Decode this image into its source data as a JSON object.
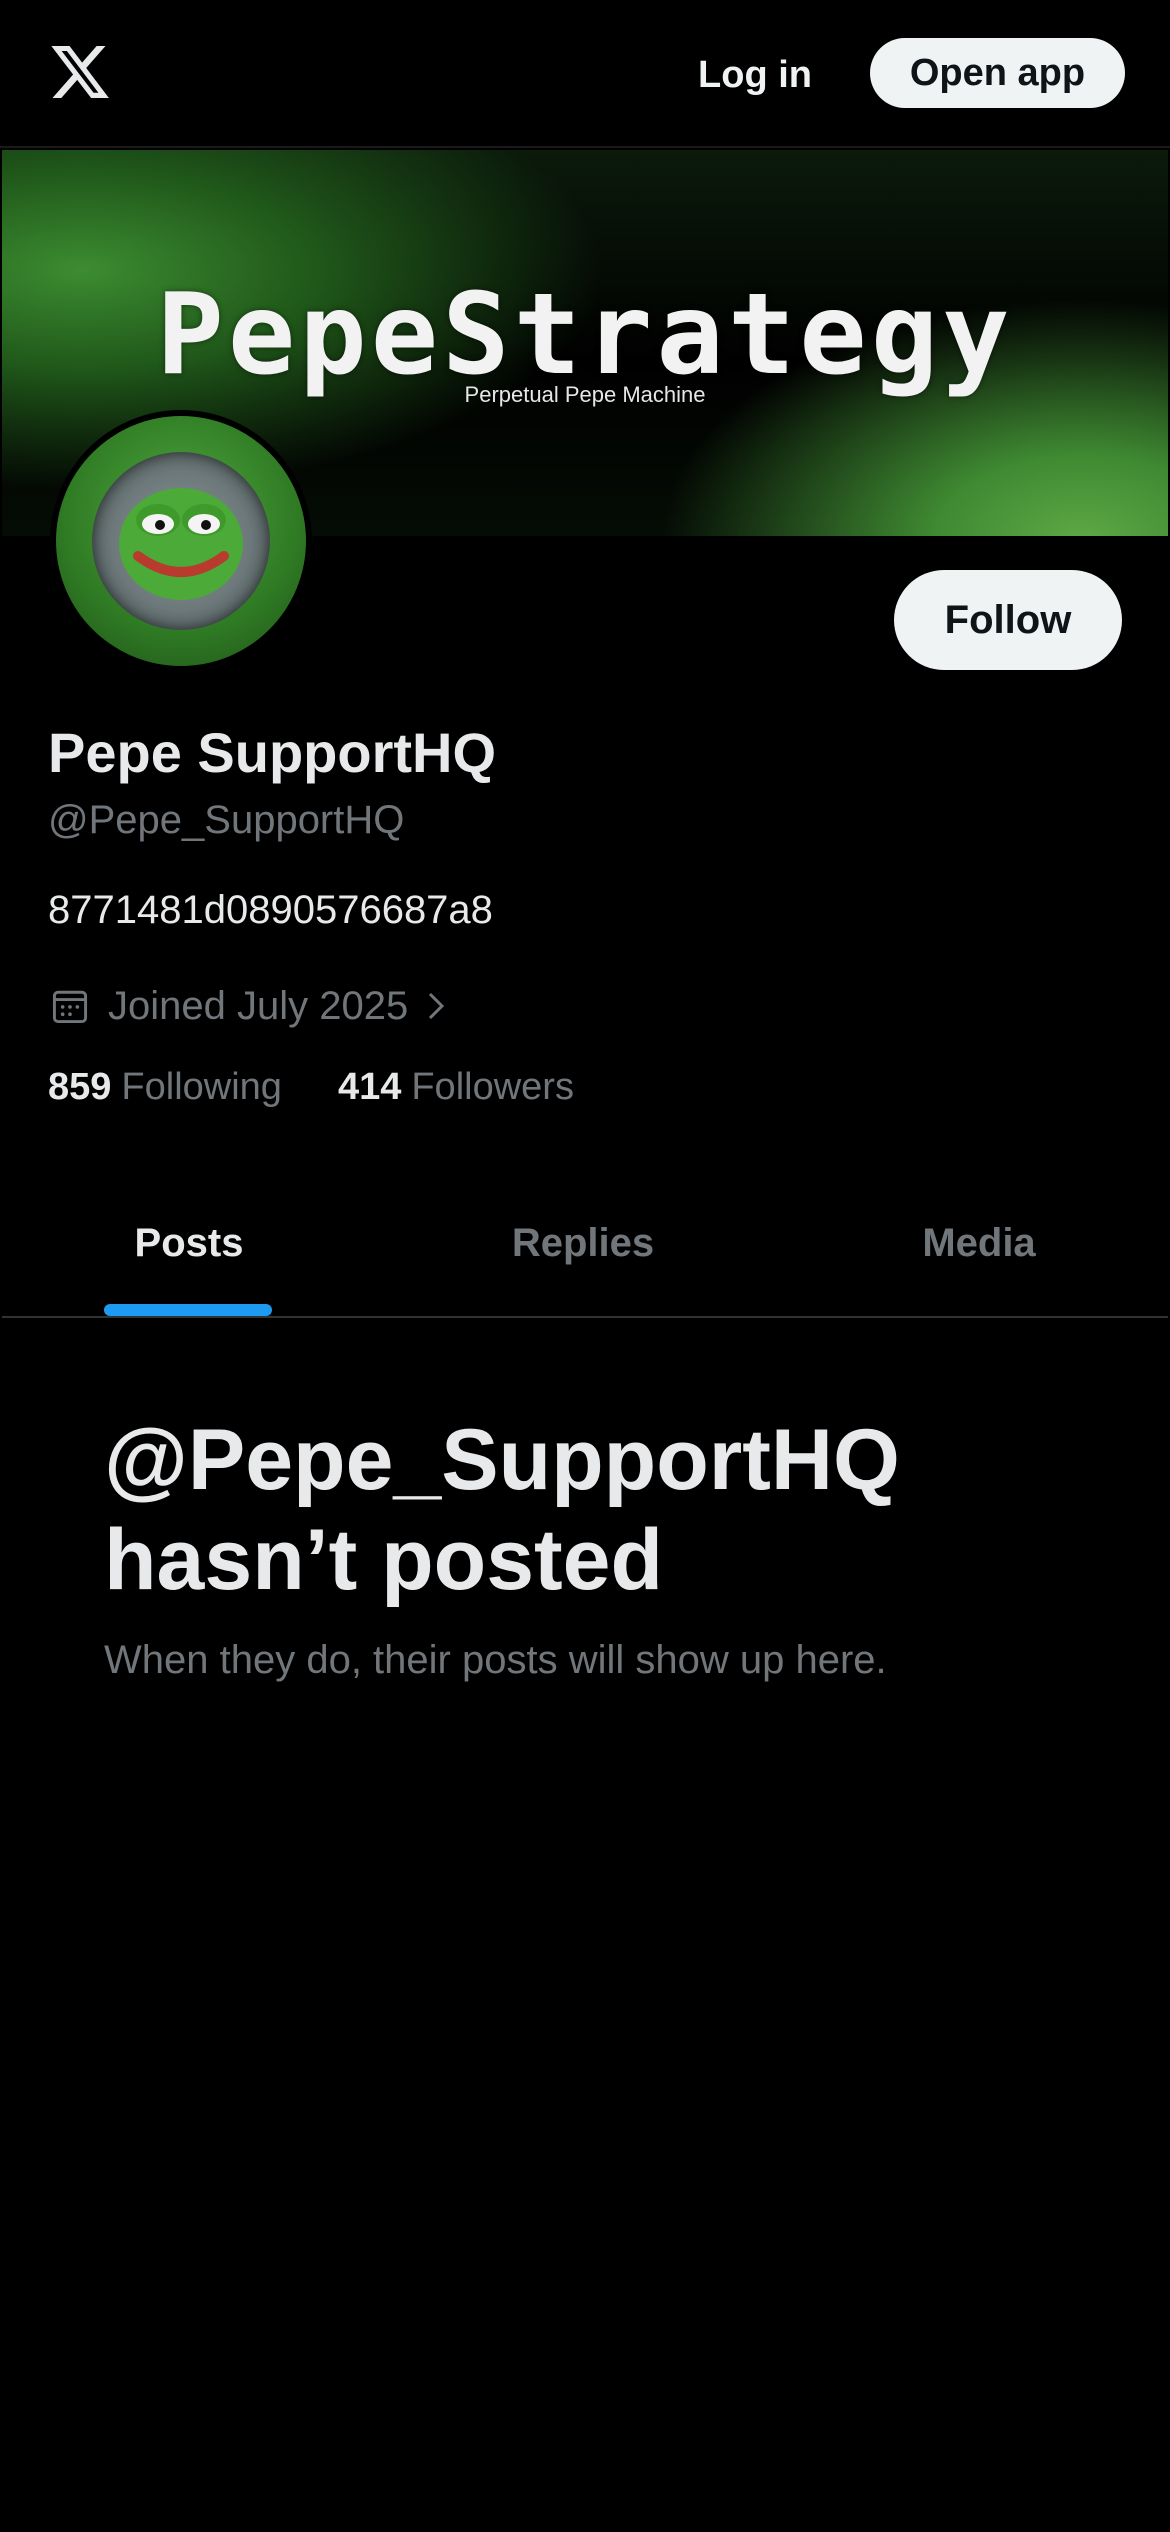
{
  "topbar": {
    "logo_icon": "x-logo-icon",
    "login_label": "Log in",
    "open_app_label": "Open app"
  },
  "banner": {
    "title": "PepeStrategy",
    "subtitle": "Perpetual Pepe Machine"
  },
  "profile": {
    "display_name": "Pepe SupportHQ",
    "handle": "@Pepe_SupportHQ",
    "bio": "8771481d0890576687a8",
    "joined": "Joined July 2025",
    "follow_label": "Follow",
    "following_count": "859",
    "following_label": "Following",
    "followers_count": "414",
    "followers_label": "Followers"
  },
  "tabs": [
    {
      "label": "Posts",
      "active": true
    },
    {
      "label": "Replies",
      "active": false
    },
    {
      "label": "Media",
      "active": false
    }
  ],
  "empty_state": {
    "title_line1": "@Pepe_SupportHQ",
    "title_line2": "hasn’t posted",
    "subtitle": "When they do, their posts will show up here."
  },
  "colors": {
    "background": "#000000",
    "accent": "#1d9bf0",
    "muted_text": "#71767b",
    "primary_text": "#e7e9ea",
    "button_bg": "#eff3f4"
  }
}
